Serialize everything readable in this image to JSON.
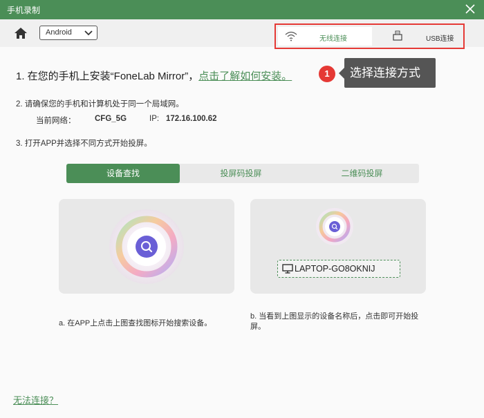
{
  "window": {
    "title": "手机录制"
  },
  "toolbar": {
    "os_selected": "Android"
  },
  "connection_tabs": [
    {
      "label": "无线连接",
      "icon": "wifi-icon",
      "active": true
    },
    {
      "label": "USB连接",
      "icon": "usb-icon",
      "active": false
    }
  ],
  "step1": {
    "text": "1. 在您的手机上安装“FoneLab Mirror”，",
    "link": "点击了解如何安装。"
  },
  "callout": {
    "number": "1",
    "text": "选择连接方式"
  },
  "step2": {
    "text": "2. 请确保您的手机和计算机处于同一个局域网。",
    "network_label": "当前网络：",
    "ssid": "CFG_5G",
    "ip_label": "IP:",
    "ip": "172.16.100.62"
  },
  "step3": {
    "text": "3. 打开APP并选择不同方式开始投屏。"
  },
  "mode_tabs": [
    {
      "label": "设备查找",
      "active": true
    },
    {
      "label": "投屏码投屏",
      "active": false
    },
    {
      "label": "二维码投屏",
      "active": false
    }
  ],
  "device": {
    "name": "LAPTOP-GO8OKNIJ"
  },
  "descriptions": {
    "a": "a. 在APP上点击上图查找图标开始搜索设备。",
    "b": "b. 当看到上图显示的设备名称后，点击即可开始投屏。"
  },
  "footer": {
    "cant_connect": "无法连接？"
  },
  "colors": {
    "brand": "#4b8e57",
    "highlight": "#e53935",
    "callout_bg": "#555555"
  }
}
